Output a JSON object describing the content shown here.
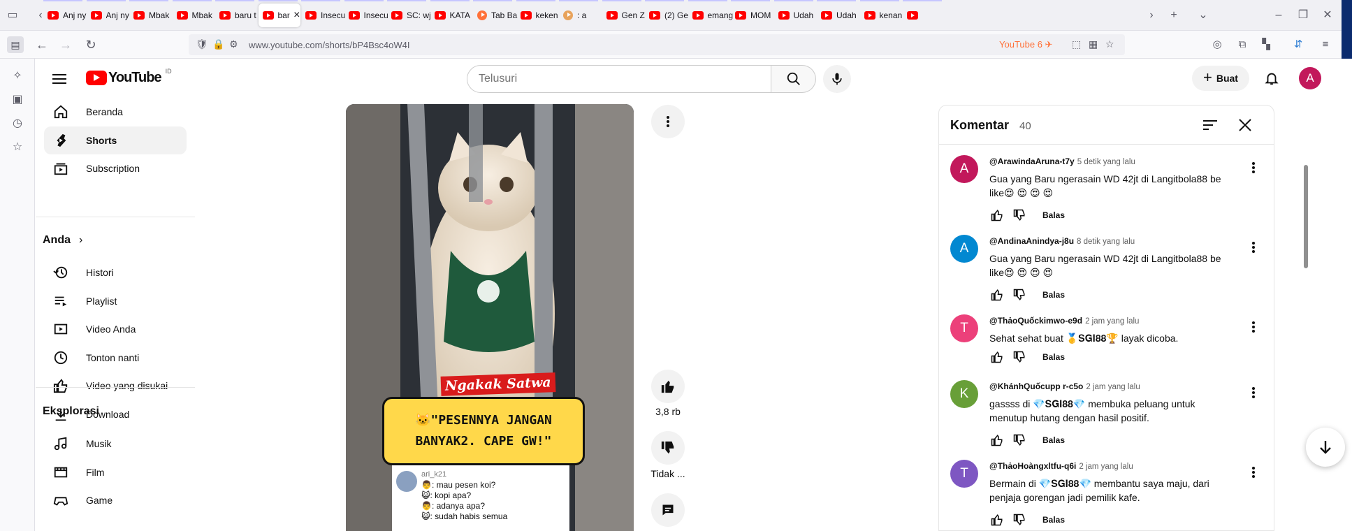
{
  "browser": {
    "tabs": [
      {
        "title": "Anj ny",
        "icon": "youtube-icon"
      },
      {
        "title": "Anj ny",
        "icon": "youtube-icon"
      },
      {
        "title": "Mbak",
        "icon": "youtube-icon"
      },
      {
        "title": "Mbak",
        "icon": "youtube-icon"
      },
      {
        "title": "baru t",
        "icon": "youtube-icon"
      },
      {
        "title": "bar",
        "icon": "youtube-icon",
        "active": true
      },
      {
        "title": "Insecu",
        "icon": "youtube-icon"
      },
      {
        "title": "Insecu",
        "icon": "youtube-icon"
      },
      {
        "title": "SC: wj",
        "icon": "youtube-icon"
      },
      {
        "title": "KATA",
        "icon": "youtube-icon"
      },
      {
        "title": "Tab Ba",
        "icon": "firefox-icon"
      },
      {
        "title": "keken",
        "icon": "youtube-icon"
      },
      {
        "title": ": a",
        "icon": "emoji-icon"
      },
      {
        "title": "Gen Z",
        "icon": "youtube-icon"
      },
      {
        "title": "(2) Ge",
        "icon": "youtube-icon"
      },
      {
        "title": "emang",
        "icon": "youtube-icon"
      },
      {
        "title": "MOM",
        "icon": "youtube-icon"
      },
      {
        "title": "Udah",
        "icon": "youtube-icon"
      },
      {
        "title": "Udah",
        "icon": "youtube-icon"
      },
      {
        "title": "kenan",
        "icon": "youtube-icon"
      },
      {
        "title": "",
        "icon": "youtube-icon"
      }
    ],
    "url": "www.youtube.com/shorts/bP4Bsc4oW4I",
    "yt_extension": "YouTube 6"
  },
  "youtube": {
    "logo_text": "YouTube",
    "country": "ID",
    "search_placeholder": "Telusuri",
    "create_label": "Buat",
    "avatar_letter": "A",
    "guide": {
      "main": [
        {
          "label": "Beranda",
          "icon": "home-icon"
        },
        {
          "label": "Shorts",
          "icon": "shorts-icon",
          "active": true
        },
        {
          "label": "Subscription",
          "icon": "subscriptions-icon"
        }
      ],
      "you_heading": "Anda",
      "you": [
        {
          "label": "Histori",
          "icon": "history-icon"
        },
        {
          "label": "Playlist",
          "icon": "playlist-icon"
        },
        {
          "label": "Video Anda",
          "icon": "your-videos-icon"
        },
        {
          "label": "Tonton nanti",
          "icon": "watch-later-icon"
        },
        {
          "label": "Video yang disukai",
          "icon": "liked-videos-icon"
        },
        {
          "label": "Download",
          "icon": "download-icon"
        }
      ],
      "explore_heading": "Eksplorasi",
      "explore": [
        {
          "label": "Musik",
          "icon": "music-icon"
        },
        {
          "label": "Film",
          "icon": "film-icon"
        },
        {
          "label": "Game",
          "icon": "gaming-icon"
        }
      ]
    },
    "short": {
      "brand_label": "Ngakak Satwa",
      "caption_line1": "🐱\"PESENNYA JANGAN",
      "caption_line2": "BANYAK2. CAPE GW!\"",
      "chat_user": "ari_k21",
      "chat_lines": [
        "👨: mau pesen koi?",
        "😺: kopi apa?",
        "👨: adanya apa?",
        "😺: sudah habis semua"
      ],
      "like_count": "3,8 rb",
      "dislike_label": "Tidak ..."
    },
    "comments": {
      "title": "Komentar",
      "count": "40",
      "items": [
        {
          "avatar": "A",
          "color": "#c2185b",
          "author": "@ArawindaAruna-t7y",
          "time": "5 detik yang lalu",
          "text": "Gua yang Baru ngerasain WD 42jt di Langitbola88 be like😍 😍 😍 😍",
          "reply": "Balas"
        },
        {
          "avatar": "A",
          "color": "#0288d1",
          "author": "@AndinaAnindya-j8u",
          "time": "8 detik yang lalu",
          "text": "Gua yang Baru ngerasain WD 42jt di Langitbola88 be like😍 😍 😍 😍",
          "reply": "Balas"
        },
        {
          "avatar": "T",
          "color": "#ec407a",
          "author": "@ThảoQuốckimwo-e9d",
          "time": "2 jam yang lalu",
          "text": "Sehat sehat buat 🥇𝐒𝐆𝐈𝟖𝟖🏆 layak dicoba.",
          "reply": "Balas"
        },
        {
          "avatar": "K",
          "color": "#689f38",
          "author": "@KhánhQuốcupp r-c5o",
          "time": "2 jam yang lalu",
          "text": "gassss di  💎𝐒𝐆𝐈𝟖𝟖💎 membuka peluang untuk menutup hutang dengan hasil positif.",
          "reply": "Balas"
        },
        {
          "avatar": "T",
          "color": "#7e57c2",
          "author": "@ThảoHoàngxltfu-q6i",
          "time": "2 jam yang lalu",
          "text": "Bermain di  💎𝐒𝐆𝐈𝟖𝟖💎 membantu saya maju, dari penjaja gorengan jadi pemilik kafe.",
          "reply": "Balas"
        }
      ]
    }
  }
}
